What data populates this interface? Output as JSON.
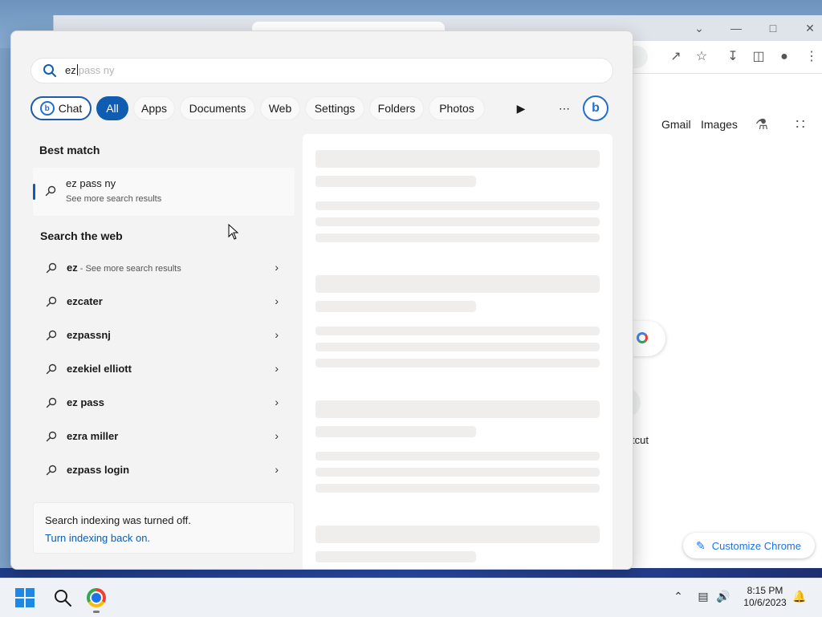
{
  "search": {
    "typed": "ez",
    "suggestion": "pass ny"
  },
  "filters": {
    "chat_label": "Chat",
    "all_label": "All",
    "apps_label": "Apps",
    "documents_label": "Documents",
    "web_label": "Web",
    "settings_label": "Settings",
    "folders_label": "Folders",
    "photos_label": "Photos"
  },
  "best_match": {
    "heading": "Best match",
    "title": "ez pass ny",
    "subtitle": "See more search results"
  },
  "web_results": {
    "heading": "Search the web",
    "items": [
      {
        "query": "ez",
        "sub": " - See more search results"
      },
      {
        "query": "ezcater",
        "sub": ""
      },
      {
        "query": "ezpassnj",
        "sub": ""
      },
      {
        "query": "ezekiel elliott",
        "sub": ""
      },
      {
        "query": "ez pass",
        "sub": ""
      },
      {
        "query": "ezra miller",
        "sub": ""
      },
      {
        "query": "ezpass login",
        "sub": ""
      }
    ]
  },
  "indexing": {
    "message": "Search indexing was turned off.",
    "link": "Turn indexing back on."
  },
  "chrome": {
    "gmail_link": "Gmail",
    "images_link": "Images",
    "shortcut_partial": "tcut",
    "customize_label": "Customize Chrome"
  },
  "taskbar": {
    "time": "8:15 PM",
    "date": "10/6/2023"
  },
  "colors": {
    "accent": "#0f5cb0",
    "link": "#0f5cb0",
    "chrome_blue": "#1a73e8"
  }
}
